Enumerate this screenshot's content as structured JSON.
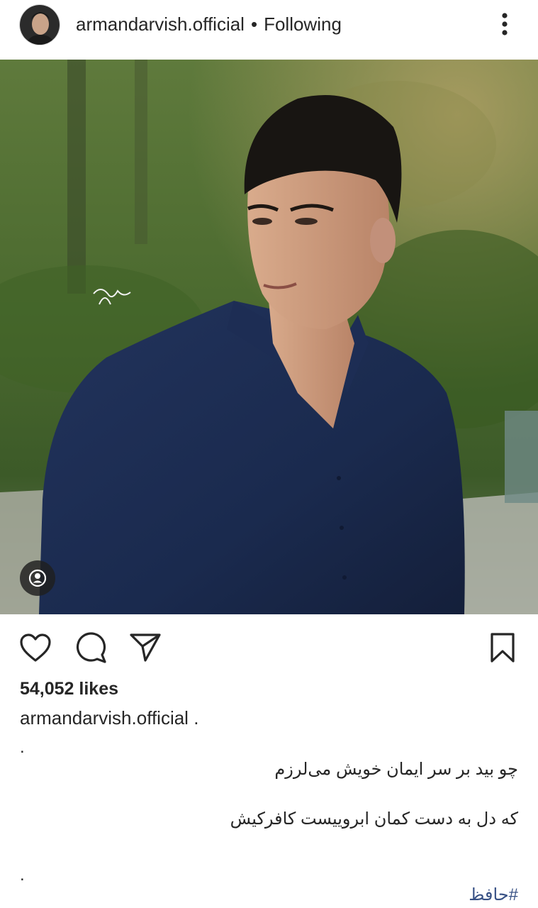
{
  "header": {
    "username": "armandarvish.official",
    "separator": "•",
    "follow_status": "Following"
  },
  "post": {
    "likes": "54,052 likes",
    "caption_username": "armandarvish.official",
    "caption_after_username": ".",
    "caption_lines": [
      ".",
      "چو بید بر سر ایمان خویش می‌لرزم",
      "که دل به دست کمان ابروییست کافرکیش",
      ".",
      "#حافظ"
    ]
  },
  "icons": {
    "more": "more-vertical-icon",
    "like": "heart-icon",
    "comment": "comment-icon",
    "share": "share-icon",
    "save": "bookmark-icon",
    "tagged": "user-tag-icon"
  },
  "colors": {
    "text": "#262626",
    "hashtag": "#385185",
    "shirt": "#1a2a4e"
  }
}
